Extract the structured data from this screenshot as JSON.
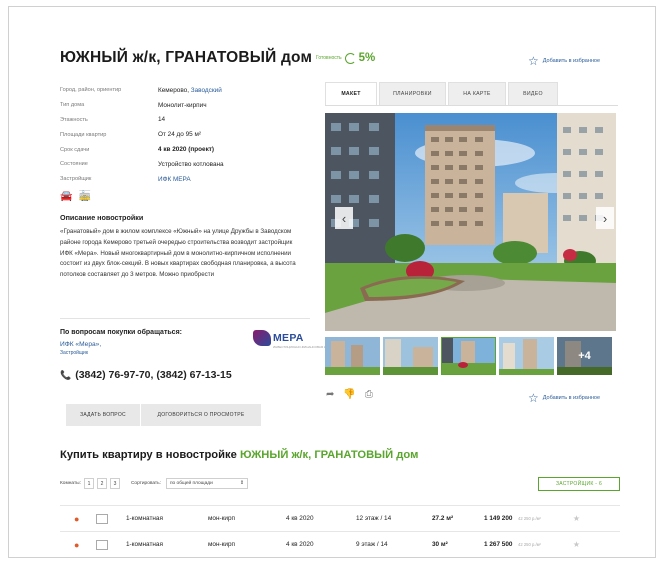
{
  "header": {
    "title": "ЮЖНЫЙ ж/к, ГРАНАТОВЫЙ дом",
    "readiness_label": "Готовность",
    "readiness_value": "5%",
    "favorite_label": "Добавить в избранное"
  },
  "properties": [
    {
      "key": "Город, район, ориентир",
      "value": "Кемерово, ",
      "link": "Заводский"
    },
    {
      "key": "Тип дома",
      "value": "Монолит-кирпич"
    },
    {
      "key": "Этажность",
      "value": "14"
    },
    {
      "key": "Площади квартир",
      "value": "От 24 до 95 м²"
    },
    {
      "key": "Срок сдачи",
      "value": "4 кв 2020 (проект)"
    },
    {
      "key": "Состояние",
      "value": "Устройство котлована"
    },
    {
      "key": "Застройщик",
      "value": "",
      "link": "ИФК МЕРА"
    }
  ],
  "description": {
    "title": "Описание новостройки",
    "text": "«Гранатовый» дом в жилом комплексе «Южный» на улице Дружбы в Заводском районе города Кемерово третьей очередью строительства возводит застройщик ИФК «Мера». Новый многоквартирный дом в монолитно-кирпичном исполнении состоит из двух блок-секций. В новых квартирах свободная планировка, а высота потолков составляет до 3 метров. Можно приобрести"
  },
  "contacts": {
    "title": "По вопросам покупки обращаться:",
    "developer": "ИФК «Мера»,",
    "role": "Застройщик",
    "logo_text": "МЕРА",
    "logo_sub": "ИНВЕСТИЦИОННО-ФИНАНСОВАЯ КОМПАНИЯ",
    "phones": "(3842) 76-97-70, (3842) 67-13-15"
  },
  "buttons": {
    "ask": "ЗАДАТЬ ВОПРОС",
    "viewing": "ДОГОВОРИТЬСЯ О ПРОСМОТРЕ"
  },
  "tabs": [
    "МАКЕТ",
    "ПЛАНИРОВКИ",
    "НА КАРТЕ",
    "ВИДЕО"
  ],
  "gallery": {
    "more_label": "+4",
    "prev": "‹",
    "next": "›"
  },
  "buy": {
    "title_prefix": "Купить квартиру в новостройке ",
    "title_highlight": "ЮЖНЫЙ ж/к, ГРАНАТОВЫЙ дом",
    "rooms_label": "Комнаты:",
    "rooms": [
      "1",
      "2",
      "3"
    ],
    "sort_label": "Сортировать:",
    "sort_value": "по общей площади",
    "developer_button": "ЗАСТРОЙЩИК - 6"
  },
  "apartments": [
    {
      "type": "1-комнатная",
      "material": "мон-кирп",
      "deadline": "4 кв 2020",
      "floor": "12 этаж / 14",
      "area": "27.2 м²",
      "price": "1 149 200",
      "ppm": "42 250 р./м²"
    },
    {
      "type": "1-комнатная",
      "material": "мон-кирп",
      "deadline": "4 кв 2020",
      "floor": "9 этаж / 14",
      "area": "30 м²",
      "price": "1 267 500",
      "ppm": "42 250 р./м²"
    }
  ],
  "colors": {
    "accent_green": "#5aa52d",
    "link_blue": "#2a5c9a"
  }
}
